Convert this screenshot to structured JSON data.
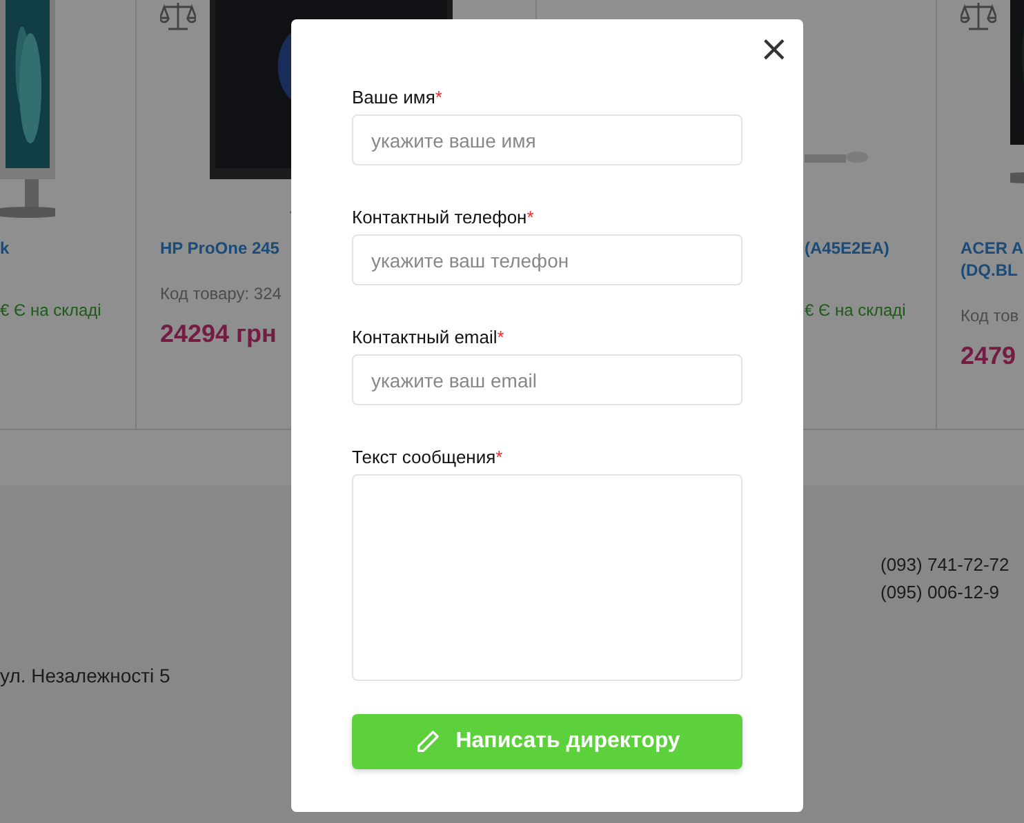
{
  "products": [
    {
      "kind": "edge",
      "title": "k",
      "stock": "€ Є на складі"
    },
    {
      "kind": "full",
      "title": "HP ProOne 245",
      "code": "Код товару: 324",
      "price": "24294 грн"
    },
    {
      "kind": "shifted",
      "title": "(A45E2EA)",
      "stock": "€ Є на складі"
    },
    {
      "kind": "full",
      "title": "ACER A (DQ.BL",
      "code": "Код тов",
      "price": "2479"
    }
  ],
  "footer": {
    "address": "ул. Незалежності 5",
    "phones": [
      "(093) 741-72-72",
      "(095) 006-12-9"
    ]
  },
  "modal": {
    "close": "×",
    "submit": "Написать директору",
    "fields": [
      {
        "kind": "input",
        "label": "Ваше имя",
        "mark": "*",
        "placeholder": "укажите ваше имя"
      },
      {
        "kind": "input",
        "label": "Контактный телефон",
        "mark": "*",
        "placeholder": "укажите ваш телефон"
      },
      {
        "kind": "input",
        "label": "Контактный email",
        "mark": "*",
        "placeholder": "укажите ваш email"
      },
      {
        "kind": "textarea",
        "label": "Текст сообщения",
        "mark": "*"
      }
    ]
  }
}
